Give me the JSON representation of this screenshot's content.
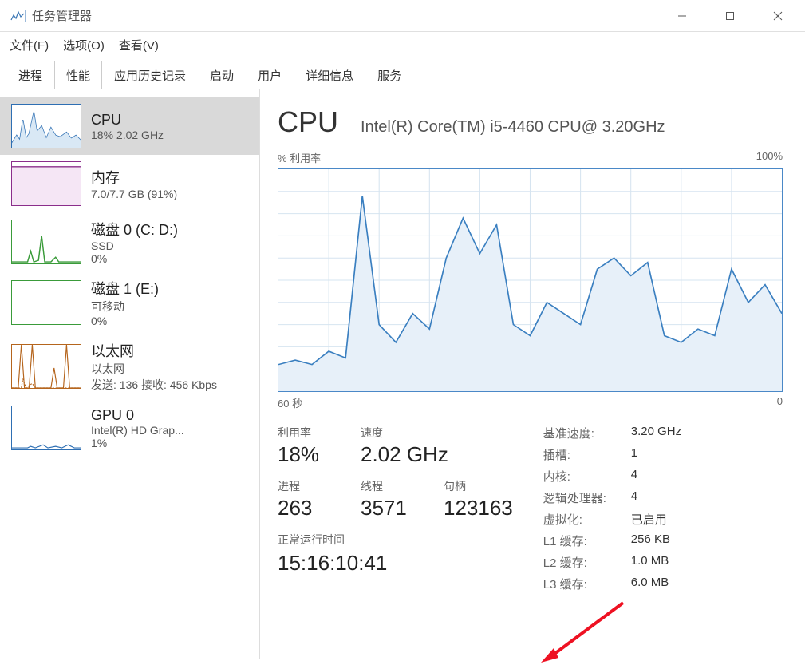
{
  "window": {
    "title": "任务管理器"
  },
  "menu": {
    "file": "文件(F)",
    "options": "选项(O)",
    "view": "查看(V)"
  },
  "tabs": {
    "processes": "进程",
    "performance": "性能",
    "history": "应用历史记录",
    "startup": "启动",
    "users": "用户",
    "details": "详细信息",
    "services": "服务"
  },
  "sidebar": {
    "cpu": {
      "title": "CPU",
      "sub": "18% 2.02 GHz"
    },
    "memory": {
      "title": "内存",
      "sub": "7.0/7.7 GB (91%)"
    },
    "disk0": {
      "title": "磁盘 0 (C: D:)",
      "sub": "SSD",
      "sub2": "0%"
    },
    "disk1": {
      "title": "磁盘 1 (E:)",
      "sub": "可移动",
      "sub2": "0%"
    },
    "ethernet": {
      "title": "以太网",
      "sub": "以太网",
      "sub2": "发送: 136 接收: 456 Kbps"
    },
    "gpu": {
      "title": "GPU 0",
      "sub": "Intel(R) HD Grap...",
      "sub2": "1%"
    }
  },
  "main": {
    "title": "CPU",
    "subtitle": "Intel(R) Core(TM) i5-4460 CPU@ 3.20GHz",
    "chart_left_label": "% 利用率",
    "chart_right_label": "100%",
    "chart_bottom_left": "60 秒",
    "chart_bottom_right": "0",
    "stats": {
      "utilization_label": "利用率",
      "utilization": "18%",
      "speed_label": "速度",
      "speed": "2.02 GHz",
      "processes_label": "进程",
      "processes": "263",
      "threads_label": "线程",
      "threads": "3571",
      "handles_label": "句柄",
      "handles": "123163",
      "uptime_label": "正常运行时间",
      "uptime": "15:16:10:41"
    },
    "specs": {
      "base_speed_label": "基准速度:",
      "base_speed": "3.20 GHz",
      "sockets_label": "插槽:",
      "sockets": "1",
      "cores_label": "内核:",
      "cores": "4",
      "logical_label": "逻辑处理器:",
      "logical": "4",
      "virtualization_label": "虚拟化:",
      "virtualization": "已启用",
      "l1_label": "L1 缓存:",
      "l1": "256 KB",
      "l2_label": "L2 缓存:",
      "l2": "1.0 MB",
      "l3_label": "L3 缓存:",
      "l3": "6.0 MB"
    }
  },
  "chart_data": {
    "type": "area",
    "title": "% 利用率",
    "ylabel": "% 利用率",
    "ylim": [
      0,
      100
    ],
    "xlim_label": [
      "60 秒",
      "0"
    ],
    "x": [
      0,
      2,
      4,
      6,
      8,
      10,
      12,
      14,
      16,
      18,
      20,
      22,
      24,
      26,
      28,
      30,
      32,
      34,
      36,
      38,
      40,
      42,
      44,
      46,
      48,
      50,
      52,
      54,
      56,
      58,
      60
    ],
    "values": [
      12,
      14,
      12,
      18,
      15,
      88,
      30,
      22,
      35,
      28,
      60,
      78,
      62,
      75,
      30,
      25,
      40,
      35,
      30,
      55,
      60,
      52,
      58,
      25,
      22,
      28,
      25,
      55,
      40,
      48,
      35
    ]
  }
}
